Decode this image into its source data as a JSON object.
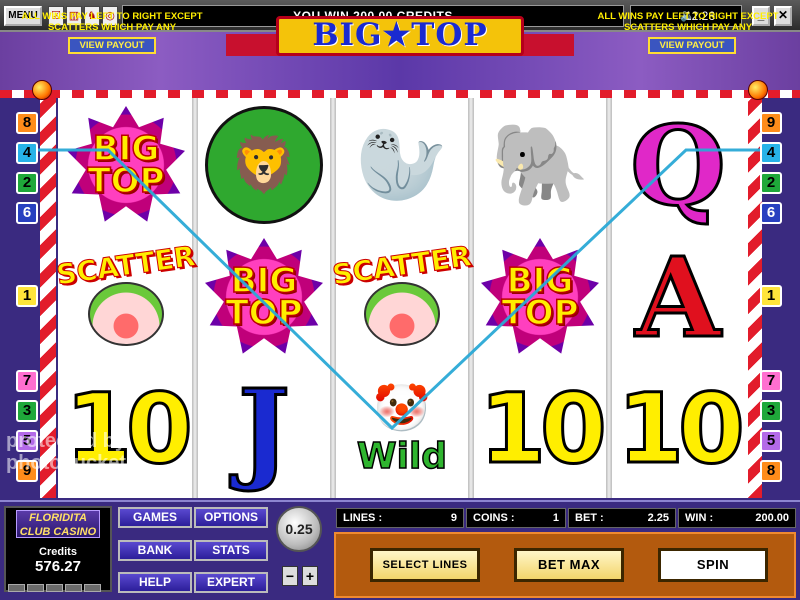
{
  "topbar": {
    "menu_label": "MENU",
    "message": "YOU WIN 200.00 CREDITS",
    "clock": "12:26",
    "speaker_icon": "🔈"
  },
  "banner": {
    "left_text": "ALL WINS PAY LEFT TO RIGHT EXCEPT SCATTERS WHICH PAY ANY",
    "right_text": "ALL WINS PAY LEFT TO RIGHT EXCEPT SCATTERS WHICH PAY ANY",
    "view_payout": "VIEW PAYOUT",
    "title": "BIG★TOP"
  },
  "line_numbers": {
    "left_top": [
      "8",
      "4",
      "2",
      "6"
    ],
    "left_mid": "1",
    "left_bottom": [
      "7",
      "3",
      "5",
      "9"
    ],
    "right_top": [
      "9",
      "4",
      "2",
      "6"
    ],
    "right_mid": "1",
    "right_bottom": [
      "7",
      "3",
      "5",
      "8"
    ]
  },
  "reels": {
    "big_top_1": "BIG",
    "big_top_2": "TOP",
    "scatter": "SCATTER",
    "ten": "10",
    "jack": "J",
    "queen": "Q",
    "ace": "A",
    "wild": "Wild"
  },
  "sidebar": {
    "casino_name": "FLORIDITA CLUB CASINO",
    "credits_label": "Credits",
    "credits_value": "576.27"
  },
  "menu_buttons": {
    "games": "GAMES",
    "options": "OPTIONS",
    "bank": "BANK",
    "stats": "STATS",
    "help": "HELP",
    "expert": "EXPERT"
  },
  "coin": {
    "value": "0.25",
    "minus": "−",
    "plus": "+"
  },
  "status": {
    "lines_label": "LINES :",
    "lines_value": "9",
    "coins_label": "COINS :",
    "coins_value": "1",
    "bet_label": "BET :",
    "bet_value": "2.25",
    "win_label": "WIN :",
    "win_value": "200.00"
  },
  "actions": {
    "select_lines": "SELECT LINES",
    "bet_max": "BET MAX",
    "spin": "SPIN"
  },
  "watermark": {
    "line1": "protected by",
    "line2": "photobucket"
  },
  "colors": {
    "accent": "#3a2a80",
    "payline": "#2aa9d6",
    "logo_yellow": "#f4c30a"
  }
}
